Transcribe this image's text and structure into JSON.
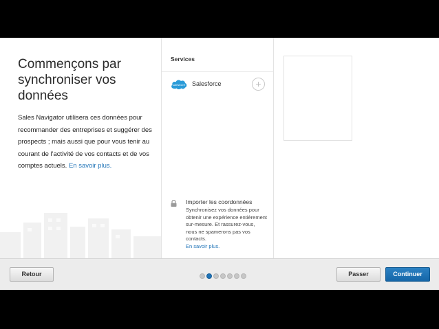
{
  "intro": {
    "title": "Commençons par synchroniser vos données",
    "description": "Sales Navigator utilisera ces données pour recommander des entreprises et suggérer des prospects ; mais aussi que pour vous tenir au courant de l'activité de vos contacts et de vos comptes actuels.",
    "link_label": "En savoir plus."
  },
  "services": {
    "heading": "Services",
    "items": [
      {
        "name": "Salesforce",
        "icon": "salesforce-logo",
        "add_icon": "+"
      }
    ]
  },
  "import": {
    "icon": "lock-icon",
    "title": "Importer les coordonnées",
    "description": "Synchronisez vos données pour obtenir une expérience entièrement sur-mesure. Et rassurez-vous, nous ne spamerons pas vos contacts.",
    "link_label": "En savoir plus."
  },
  "footer": {
    "back_label": "Retour",
    "skip_label": "Passer",
    "continue_label": "Continuer",
    "steps_total": 7,
    "current_step": 2
  },
  "colors": {
    "accent": "#1f73b7",
    "primary_button": "#1a6aad",
    "footer_bg": "#ececec"
  }
}
